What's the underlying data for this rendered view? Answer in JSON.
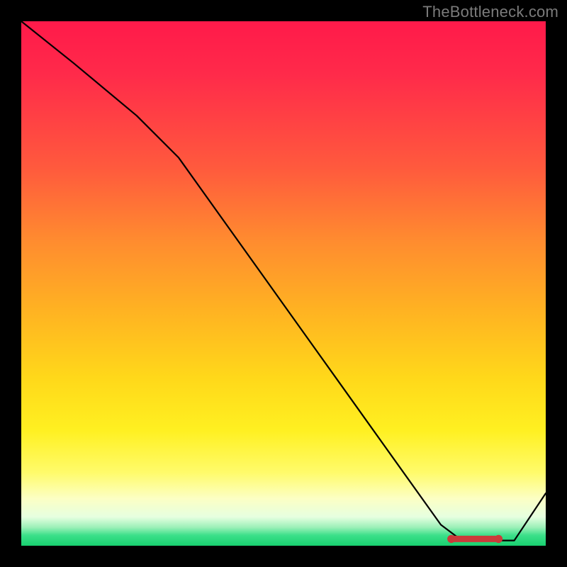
{
  "watermark": "TheBottleneck.com",
  "chart_data": {
    "type": "line",
    "title": "",
    "xlabel": "",
    "ylabel": "",
    "xlim": [
      0,
      100
    ],
    "ylim": [
      0,
      100
    ],
    "grid": false,
    "series": [
      {
        "name": "curve",
        "x": [
          0,
          10,
          22,
          30,
          40,
          50,
          60,
          70,
          80,
          84,
          90,
          94,
          100
        ],
        "values": [
          100,
          92,
          82,
          74,
          60,
          46,
          32,
          18,
          4,
          1,
          1,
          1,
          10
        ]
      }
    ],
    "flat_segment": {
      "x_start": 82,
      "x_end": 91,
      "y": 1.3
    },
    "colors": {
      "curve": "#000000",
      "flat_marker": "#cc3a3a",
      "gradient_top": "#ff1a4a",
      "gradient_mid": "#ffd81a",
      "gradient_bottom": "#18d070",
      "bg": "#000000"
    }
  }
}
